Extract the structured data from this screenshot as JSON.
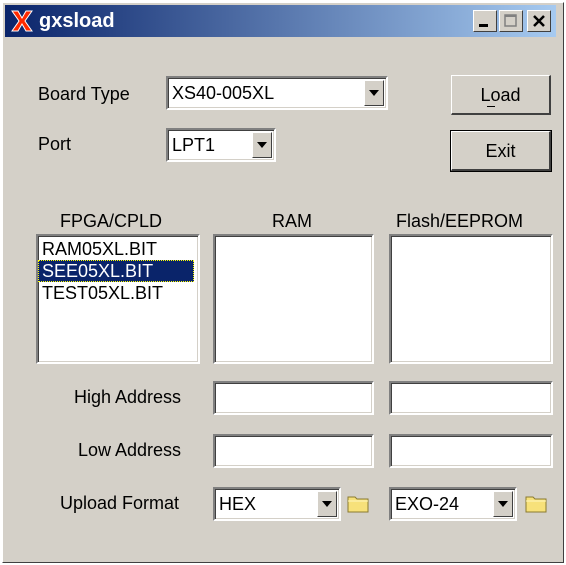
{
  "window": {
    "title": "gxsload",
    "controls": {
      "minimize": "minimize-icon",
      "maximize": "maximize-icon",
      "close": "close-icon"
    }
  },
  "board_type": {
    "label": "Board Type",
    "value": "XS40-005XL"
  },
  "port": {
    "label": "Port",
    "value": "LPT1"
  },
  "buttons": {
    "load_label": "Load",
    "exit_label": "Exit"
  },
  "columns": {
    "fpga": {
      "header": "FPGA/CPLD",
      "items": [
        "RAM05XL.BIT",
        "SEE05XL.BIT",
        "TEST05XL.BIT"
      ],
      "selected": "SEE05XL.BIT"
    },
    "ram": {
      "header": "RAM",
      "items": []
    },
    "flash": {
      "header": "Flash/EEPROM",
      "items": []
    }
  },
  "fields": {
    "high_address_label": "High Address",
    "low_address_label": "Low Address",
    "upload_format_label": "Upload Format",
    "ram_high": "",
    "ram_low": "",
    "flash_high": "",
    "flash_low": ""
  },
  "upload_formats": {
    "ram": "HEX",
    "flash": "EXO-24"
  },
  "colors": {
    "titlebar_start": "#0a246a",
    "titlebar_end": "#a6caf0",
    "selection": "#0a246a",
    "face": "#d4d0c8"
  }
}
